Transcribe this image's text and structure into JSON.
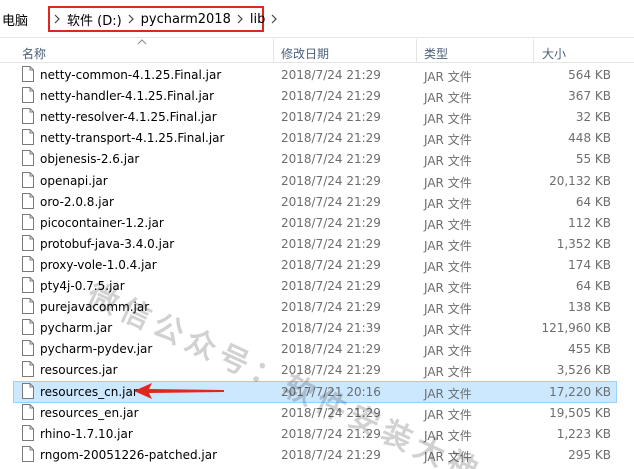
{
  "breadcrumb": {
    "first": "电脑",
    "items": [
      "软件 (D:)",
      "pycharm2018",
      "lib"
    ]
  },
  "columns": {
    "name": "名称",
    "date": "修改日期",
    "type": "类型",
    "size": "大小"
  },
  "files": [
    {
      "name": "netty-common-4.1.25.Final.jar",
      "date": "2018/7/24 21:29",
      "type": "JAR 文件",
      "size": "564 KB"
    },
    {
      "name": "netty-handler-4.1.25.Final.jar",
      "date": "2018/7/24 21:29",
      "type": "JAR 文件",
      "size": "367 KB"
    },
    {
      "name": "netty-resolver-4.1.25.Final.jar",
      "date": "2018/7/24 21:29",
      "type": "JAR 文件",
      "size": "32 KB"
    },
    {
      "name": "netty-transport-4.1.25.Final.jar",
      "date": "2018/7/24 21:29",
      "type": "JAR 文件",
      "size": "448 KB"
    },
    {
      "name": "objenesis-2.6.jar",
      "date": "2018/7/24 21:29",
      "type": "JAR 文件",
      "size": "55 KB"
    },
    {
      "name": "openapi.jar",
      "date": "2018/7/24 21:29",
      "type": "JAR 文件",
      "size": "20,132 KB"
    },
    {
      "name": "oro-2.0.8.jar",
      "date": "2018/7/24 21:29",
      "type": "JAR 文件",
      "size": "64 KB"
    },
    {
      "name": "picocontainer-1.2.jar",
      "date": "2018/7/24 21:29",
      "type": "JAR 文件",
      "size": "112 KB"
    },
    {
      "name": "protobuf-java-3.4.0.jar",
      "date": "2018/7/24 21:29",
      "type": "JAR 文件",
      "size": "1,352 KB"
    },
    {
      "name": "proxy-vole-1.0.4.jar",
      "date": "2018/7/24 21:29",
      "type": "JAR 文件",
      "size": "174 KB"
    },
    {
      "name": "pty4j-0.7.5.jar",
      "date": "2018/7/24 21:29",
      "type": "JAR 文件",
      "size": "64 KB"
    },
    {
      "name": "purejavacomm.jar",
      "date": "2018/7/24 21:29",
      "type": "JAR 文件",
      "size": "138 KB"
    },
    {
      "name": "pycharm.jar",
      "date": "2018/7/24 21:39",
      "type": "JAR 文件",
      "size": "121,960 KB"
    },
    {
      "name": "pycharm-pydev.jar",
      "date": "2018/7/24 21:29",
      "type": "JAR 文件",
      "size": "455 KB"
    },
    {
      "name": "resources.jar",
      "date": "2018/7/24 21:29",
      "type": "JAR 文件",
      "size": "3,526 KB"
    },
    {
      "name": "resources_cn.jar",
      "date": "2017/7/21 20:16",
      "type": "JAR 文件",
      "size": "17,220 KB"
    },
    {
      "name": "resources_en.jar",
      "date": "2018/7/24 21:29",
      "type": "JAR 文件",
      "size": "19,505 KB"
    },
    {
      "name": "rhino-1.7.10.jar",
      "date": "2018/7/24 21:29",
      "type": "JAR 文件",
      "size": "1,223 KB"
    },
    {
      "name": "rngom-20051226-patched.jar",
      "date": "2018/7/24 21:29",
      "type": "JAR 文件",
      "size": "295 KB"
    }
  ],
  "selected_index": 15,
  "watermark": "微信公众号：软件安装大神",
  "colors": {
    "highlight_box": "#e0271f",
    "selection_bg": "#cce8ff",
    "selection_border": "#99d1ff",
    "arrow": "#e0271f",
    "header_text": "#4c607a"
  }
}
